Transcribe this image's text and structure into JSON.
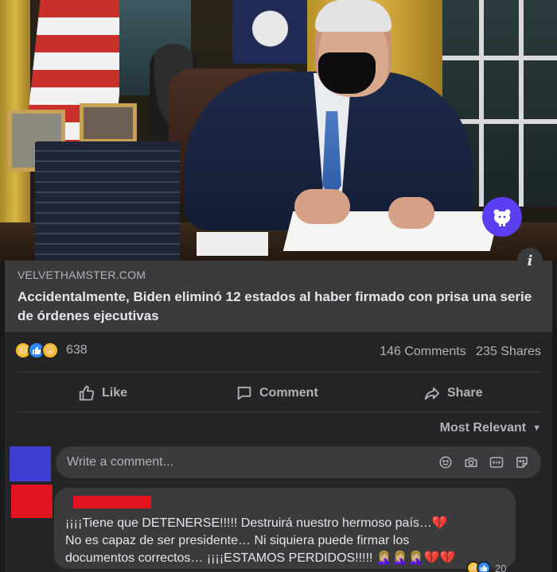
{
  "link": {
    "domain": "VELVETHAMSTER.COM",
    "title": "Accidentalmente, Biden eliminó 12 estados al haber firmado con prisa una serie de órdenes ejecutivas"
  },
  "reactions": {
    "icons": [
      "haha",
      "like",
      "wow"
    ],
    "count": "638"
  },
  "stats": {
    "comments": "146 Comments",
    "shares": "235 Shares"
  },
  "actions": {
    "like": "Like",
    "comment": "Comment",
    "share": "Share"
  },
  "sort": {
    "label": "Most Relevant"
  },
  "composer": {
    "placeholder": "Write a comment...",
    "icons": [
      "emoji-icon",
      "camera-icon",
      "gif-icon",
      "sticker-icon"
    ]
  },
  "comment": {
    "line1": "¡¡¡¡Tiene que DETENERSE!!!!! Destruirá nuestro hermoso país…💔",
    "line2": "No es capaz de ser presidente… Ni siquiera puede firmar los",
    "line3": "documentos correctos… ¡¡¡¡ESTAMOS PERDIDOS!!!!! 🤦🏼‍♀️🤦🏼‍♀️🤦🏼‍♀️💔💔",
    "reaction_count": "20"
  },
  "colors": {
    "background": "#18191a",
    "card": "#242526",
    "surface": "#3a3b3c",
    "text": "#e4e6eb",
    "muted": "#b0b3b8",
    "badge": "#5b3df2",
    "redacted": "#e0141e",
    "avatar_blue": "#3e3ed2"
  }
}
